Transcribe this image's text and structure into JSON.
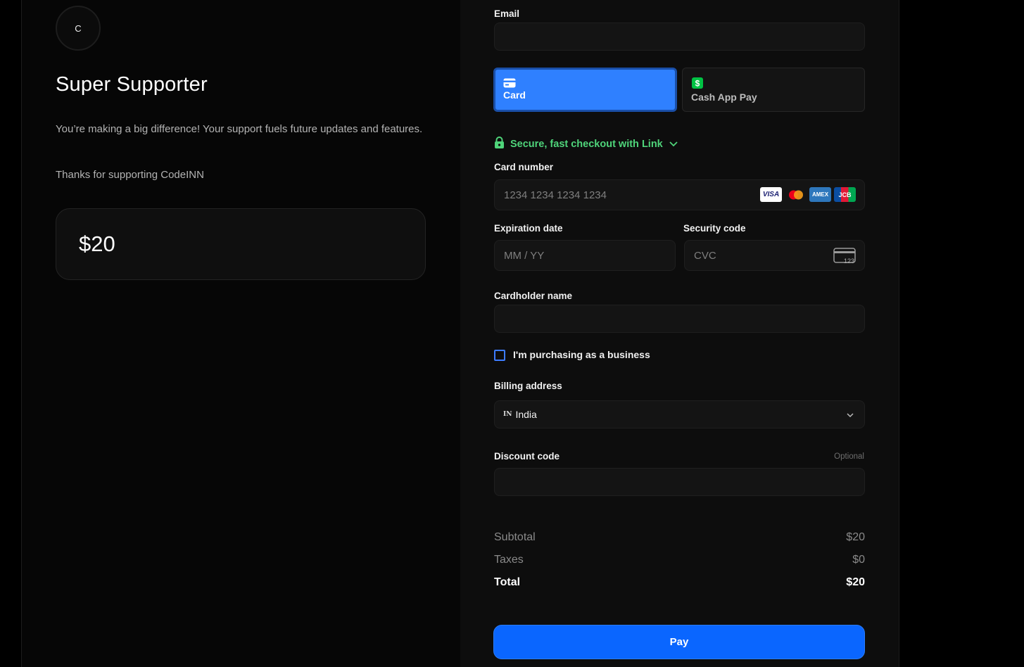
{
  "product": {
    "avatar_letter": "C",
    "title": "Super Supporter",
    "description": "You’re making a big difference! Your support fuels future updates and features.",
    "thanks": "Thanks for supporting CodeINN",
    "amount": "$20"
  },
  "form": {
    "email_label": "Email",
    "email_value": "",
    "methods": [
      {
        "label": "Card",
        "icon": "card-icon",
        "selected": true
      },
      {
        "label": "Cash App Pay",
        "icon": "cash-app-icon",
        "selected": false
      }
    ],
    "link_text": "Secure, fast checkout with Link",
    "card_number_label": "Card number",
    "card_number_placeholder": "1234 1234 1234 1234",
    "card_brands": [
      "VISA",
      "Mastercard",
      "AMEX",
      "JCB"
    ],
    "expiration_label": "Expiration date",
    "expiration_placeholder": "MM / YY",
    "security_label": "Security code",
    "security_placeholder": "CVC",
    "cvc_icon_text": "123",
    "cardholder_label": "Cardholder name",
    "cardholder_value": "",
    "business_label": "I'm purchasing as a business",
    "business_checked": false,
    "billing_label": "Billing address",
    "billing_flag": "IN",
    "billing_country": "India",
    "discount_label": "Discount code",
    "discount_optional": "Optional",
    "discount_value": ""
  },
  "summary": {
    "subtotal_label": "Subtotal",
    "subtotal_value": "$20",
    "taxes_label": "Taxes",
    "taxes_value": "$0",
    "total_label": "Total",
    "total_value": "$20"
  },
  "pay_label": "Pay",
  "colors": {
    "accent": "#0a66ff",
    "selected_method": "#2f80ff",
    "link_green": "#4fd47a",
    "cash_app_green": "#00c244"
  }
}
